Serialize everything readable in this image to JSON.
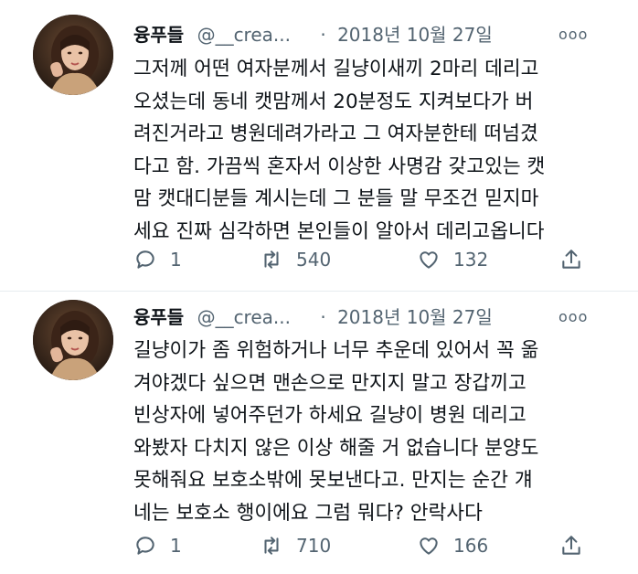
{
  "tweets": [
    {
      "author": {
        "name": "융푸들",
        "handle": "@__crea...",
        "separator": "·",
        "date": "2018년 10월 27일",
        "more": "ooo"
      },
      "lines": [
        "그저께 어떤 여자분께서 길냥이새끼 2마리 데리고",
        "오셨는데 동네 캣맘께서 20분정도 지켜보다가 버",
        "려진거라고 병원데려가라고 그 여자분한테 떠넘겼",
        "다고 함. 가끔씩 혼자서 이상한 사명감 갖고있는 캣",
        "맘 캣대디분들 계시는데 그 분들 말 무조건 믿지마",
        "세요 진짜 심각하면 본인들이 알아서 데리고옵니다"
      ],
      "actions": {
        "reply_icon": "reply-icon",
        "replies": "1",
        "retweet_icon": "retweet-icon",
        "retweets": "540",
        "like_icon": "heart-icon",
        "likes": "132",
        "share_icon": "share-icon"
      }
    },
    {
      "author": {
        "name": "융푸들",
        "handle": "@__crea...",
        "separator": "·",
        "date": "2018년 10월 27일",
        "more": "ooo"
      },
      "lines": [
        "길냥이가 좀 위험하거나 너무 추운데 있어서 꼭 옮",
        "겨야겠다 싶으면 맨손으로 만지지 말고 장갑끼고",
        "빈상자에 넣어주던가 하세요 길냥이 병원 데리고",
        "와봤자 다치지 않은 이상 해줄 거 없습니다 분양도",
        "못해줘요 보호소밖에 못보낸다고. 만지는 순간 걔",
        "네는 보호소 행이에요 그럼 뭐다? 안락사다"
      ],
      "actions": {
        "reply_icon": "reply-icon",
        "replies": "1",
        "retweet_icon": "retweet-icon",
        "retweets": "710",
        "like_icon": "heart-icon",
        "likes": "166",
        "share_icon": "share-icon"
      }
    }
  ]
}
